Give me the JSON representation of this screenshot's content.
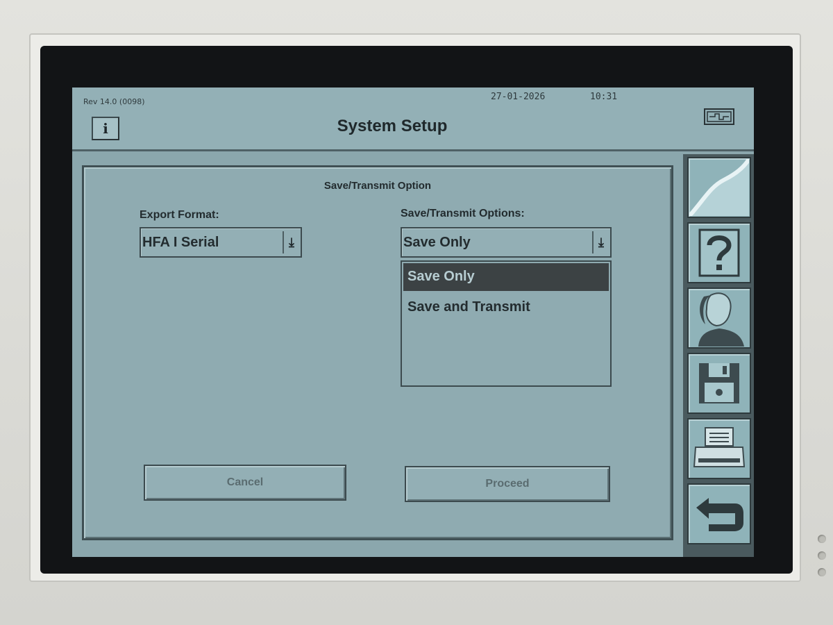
{
  "header": {
    "revision": "Rev 14.0 (0098)",
    "date": "27-01-2026",
    "time": "10:31",
    "title": "System Setup",
    "info_label": "i"
  },
  "dialog": {
    "title": "Save/Transmit Option",
    "export_format": {
      "label": "Export Format:",
      "selected": "HFA I Serial"
    },
    "save_transmit": {
      "label": "Save/Transmit Options:",
      "selected": "Save Only",
      "options": [
        "Save Only",
        "Save and Transmit"
      ],
      "highlighted_index": 0
    },
    "cancel_label": "Cancel",
    "proceed_label": "Proceed"
  },
  "toolbar": {
    "items": [
      "curve-icon",
      "help-icon",
      "patient-icon",
      "floppy-disk-icon",
      "printer-icon",
      "return-arrow-icon"
    ]
  },
  "colors": {
    "screen": "#8ba7ad",
    "header": "#93b0b6",
    "selected_option": "#3c4244",
    "toolbar_button": "#8fb3b9"
  }
}
